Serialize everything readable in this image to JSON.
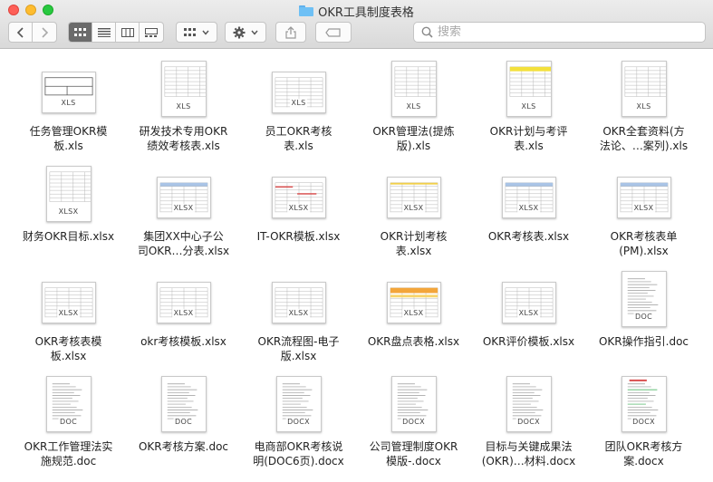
{
  "window": {
    "title": "OKR工具制度表格",
    "search_placeholder": "搜索"
  },
  "files": [
    {
      "name": "任务管理OKR模\n板.xls",
      "badge": "XLS",
      "shape": "landscape",
      "style": "header"
    },
    {
      "name": "研发技术专用OKR\n绩效考核表.xls",
      "badge": "XLS",
      "shape": "portrait",
      "style": "table"
    },
    {
      "name": "员工OKR考核\n表.xls",
      "badge": "XLS",
      "shape": "landscape",
      "style": "table"
    },
    {
      "name": "OKR管理法(提炼\n版).xls",
      "badge": "XLS",
      "shape": "portrait",
      "style": "table"
    },
    {
      "name": "OKR计划与考评\n表.xls",
      "badge": "XLS",
      "shape": "portrait",
      "style": "yellow"
    },
    {
      "name": "OKR全套资料(方\n法论、…案列).xls",
      "badge": "XLS",
      "shape": "portrait",
      "style": "table"
    },
    {
      "name": "财务OKR目标.xlsx",
      "badge": "XLSX",
      "shape": "portrait",
      "style": "table"
    },
    {
      "name": "集团XX中心子公\n司OKR…分表.xlsx",
      "badge": "XLSX",
      "shape": "landscape",
      "style": "blue"
    },
    {
      "name": "IT-OKR模板.xlsx",
      "badge": "XLSX",
      "shape": "landscape",
      "style": "red"
    },
    {
      "name": "OKR计划考核\n表.xlsx",
      "badge": "XLSX",
      "shape": "landscape",
      "style": "yellowline"
    },
    {
      "name": "OKR考核表.xlsx",
      "badge": "XLSX",
      "shape": "landscape",
      "style": "blue"
    },
    {
      "name": "OKR考核表单\n(PM).xlsx",
      "badge": "XLSX",
      "shape": "landscape",
      "style": "blue"
    },
    {
      "name": "OKR考核表模\n板.xlsx",
      "badge": "XLSX",
      "shape": "landscape",
      "style": "table"
    },
    {
      "name": "okr考核模板.xlsx",
      "badge": "XLSX",
      "shape": "landscape",
      "style": "table"
    },
    {
      "name": "OKR流程图-电子\n版.xlsx",
      "badge": "XLSX",
      "shape": "landscape",
      "style": "table"
    },
    {
      "name": "OKR盘点表格.xlsx",
      "badge": "XLSX",
      "shape": "landscape",
      "style": "orange"
    },
    {
      "name": "OKR评价模板.xlsx",
      "badge": "XLSX",
      "shape": "landscape",
      "style": "table"
    },
    {
      "name": "OKR操作指引.doc",
      "badge": "DOC",
      "shape": "portrait",
      "style": "text"
    },
    {
      "name": "OKR工作管理法实\n施规范.doc",
      "badge": "DOC",
      "shape": "portrait",
      "style": "text"
    },
    {
      "name": "OKR考核方案.doc",
      "badge": "DOC",
      "shape": "portrait",
      "style": "text"
    },
    {
      "name": "电商部OKR考核说\n明(DOC6页).docx",
      "badge": "DOCX",
      "shape": "portrait",
      "style": "text"
    },
    {
      "name": "公司管理制度OKR\n模版-.docx",
      "badge": "DOCX",
      "shape": "portrait",
      "style": "text"
    },
    {
      "name": "目标与关键成果法\n(OKR)…材料.docx",
      "badge": "DOCX",
      "shape": "portrait",
      "style": "text"
    },
    {
      "name": "团队OKR考核方\n案.docx",
      "badge": "DOCX",
      "shape": "portrait",
      "style": "greentext"
    }
  ]
}
